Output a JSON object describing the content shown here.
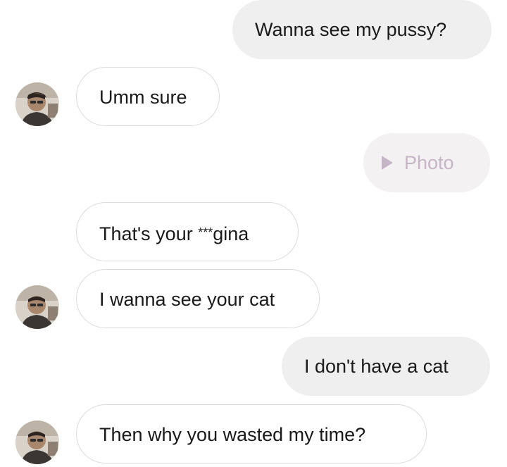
{
  "messages": [
    {
      "text": "Wanna see my pussy?"
    },
    {
      "text": "Umm sure"
    },
    {
      "label": "Photo",
      "icon": "play-icon"
    },
    {
      "prefix": "That's your ",
      "censored": "***",
      "suffix": "gina"
    },
    {
      "text": "I wanna see your cat"
    },
    {
      "text": "I don't have a cat"
    },
    {
      "text": "Then why you wasted my time?"
    }
  ],
  "colors": {
    "sent_bubble": "#efefef",
    "received_border": "#dcdcdc",
    "photo_text": "#c6b5c6"
  }
}
